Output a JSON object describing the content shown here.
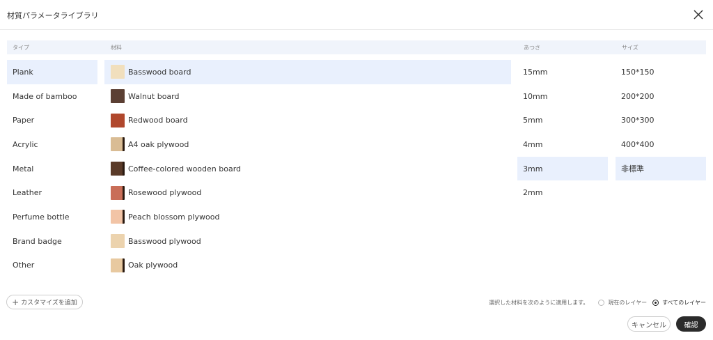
{
  "dialog": {
    "title": "材質パラメータライブラリ",
    "close_icon": "close-icon"
  },
  "columns": {
    "type": "タイプ",
    "material": "材料",
    "thickness": "あつさ",
    "size": "サイズ"
  },
  "types": [
    {
      "label": "Plank",
      "selected": true
    },
    {
      "label": "Made of bamboo",
      "selected": false
    },
    {
      "label": "Paper",
      "selected": false
    },
    {
      "label": "Acrylic",
      "selected": false
    },
    {
      "label": "Metal",
      "selected": false
    },
    {
      "label": "Leather",
      "selected": false
    },
    {
      "label": "Perfume bottle",
      "selected": false
    },
    {
      "label": "Brand badge",
      "selected": false
    },
    {
      "label": "Other",
      "selected": false
    }
  ],
  "materials": [
    {
      "label": "Basswood board",
      "color": "#f1dfbd",
      "edge": false,
      "selected": true
    },
    {
      "label": "Walnut board",
      "color": "#5b3f33",
      "edge": false,
      "selected": false
    },
    {
      "label": "Redwood board",
      "color": "#b0472c",
      "edge": false,
      "selected": false
    },
    {
      "label": "A4 oak plywood",
      "color": "#d9bc94",
      "edge": true,
      "selected": false
    },
    {
      "label": "Coffee-colored wooden board",
      "color": "#5a3a28",
      "edge": true,
      "selected": false
    },
    {
      "label": "Rosewood plywood",
      "color": "#c96e58",
      "edge": true,
      "selected": false
    },
    {
      "label": "Peach blossom plywood",
      "color": "#f2c4a6",
      "edge": true,
      "selected": false
    },
    {
      "label": "Basswood plywood",
      "color": "#ecd3ae",
      "edge": false,
      "selected": false
    },
    {
      "label": "Oak plywood",
      "color": "#e8c9a0",
      "edge": true,
      "selected": false
    }
  ],
  "thicknesses": [
    {
      "label": "15mm",
      "selected": false
    },
    {
      "label": "10mm",
      "selected": false
    },
    {
      "label": "5mm",
      "selected": false
    },
    {
      "label": "4mm",
      "selected": false
    },
    {
      "label": "3mm",
      "selected": true
    },
    {
      "label": "2mm",
      "selected": false
    }
  ],
  "sizes": [
    {
      "label": "150*150",
      "selected": false
    },
    {
      "label": "200*200",
      "selected": false
    },
    {
      "label": "300*300",
      "selected": false
    },
    {
      "label": "400*400",
      "selected": false
    },
    {
      "label": "非標準",
      "selected": true
    }
  ],
  "footer": {
    "add_custom_label": "カスタマイズを追加",
    "apply_text": "選択した材料を次のように適用します。",
    "radio_current_layer": "現在のレイヤー",
    "radio_all_layers": "すべてのレイヤー",
    "selected_radio": "all",
    "cancel_label": "キャンセル",
    "confirm_label": "確認"
  },
  "colors": {
    "selected_bg": "#e9f0fd",
    "header_bg": "#f0f4fb",
    "confirm_bg": "#2b2b2b"
  }
}
